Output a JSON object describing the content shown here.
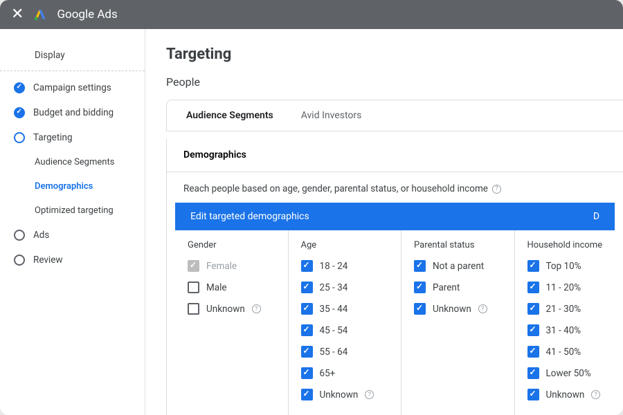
{
  "header": {
    "app_title": "Google Ads"
  },
  "sidebar": {
    "display_label": "Display",
    "items": [
      {
        "label": "Campaign settings",
        "state": "done"
      },
      {
        "label": "Budget and bidding",
        "state": "done"
      },
      {
        "label": "Targeting",
        "state": "current"
      },
      {
        "label": "Ads",
        "state": "pending"
      },
      {
        "label": "Review",
        "state": "pending"
      }
    ],
    "sub_items": [
      {
        "label": "Audience Segments",
        "active": false
      },
      {
        "label": "Demographics",
        "active": true
      },
      {
        "label": "Optimized targeting",
        "active": false
      }
    ]
  },
  "main": {
    "title": "Targeting",
    "subtitle": "People",
    "tabs": [
      {
        "label": "Audience Segments",
        "active": true
      },
      {
        "label": "Avid Investors",
        "active": false
      }
    ],
    "demographics": {
      "heading": "Demographics",
      "description": "Reach people based on age, gender, parental status, or household income",
      "blue_bar": "Edit targeted demographics",
      "blue_bar_right": "D",
      "columns": [
        {
          "header": "Gender",
          "rows": [
            {
              "label": "Female",
              "state": "disabled",
              "help": false
            },
            {
              "label": "Male",
              "state": "unchecked",
              "help": false
            },
            {
              "label": "Unknown",
              "state": "unchecked",
              "help": true
            }
          ]
        },
        {
          "header": "Age",
          "rows": [
            {
              "label": "18 - 24",
              "state": "checked",
              "help": false
            },
            {
              "label": "25 - 34",
              "state": "checked",
              "help": false
            },
            {
              "label": "35 - 44",
              "state": "checked",
              "help": false
            },
            {
              "label": "45 - 54",
              "state": "checked",
              "help": false
            },
            {
              "label": "55 - 64",
              "state": "checked",
              "help": false
            },
            {
              "label": "65+",
              "state": "checked",
              "help": false
            },
            {
              "label": "Unknown",
              "state": "checked",
              "help": true
            }
          ]
        },
        {
          "header": "Parental status",
          "rows": [
            {
              "label": "Not a parent",
              "state": "checked",
              "help": false
            },
            {
              "label": "Parent",
              "state": "checked",
              "help": false
            },
            {
              "label": "Unknown",
              "state": "checked",
              "help": true
            }
          ]
        },
        {
          "header": "Household income",
          "rows": [
            {
              "label": "Top 10%",
              "state": "checked",
              "help": false
            },
            {
              "label": "11 - 20%",
              "state": "checked",
              "help": false
            },
            {
              "label": "21 - 30%",
              "state": "checked",
              "help": false
            },
            {
              "label": "31 - 40%",
              "state": "checked",
              "help": false
            },
            {
              "label": "41 - 50%",
              "state": "checked",
              "help": false
            },
            {
              "label": "Lower 50%",
              "state": "checked",
              "help": false
            },
            {
              "label": "Unknown",
              "state": "checked",
              "help": true
            }
          ]
        }
      ]
    }
  }
}
